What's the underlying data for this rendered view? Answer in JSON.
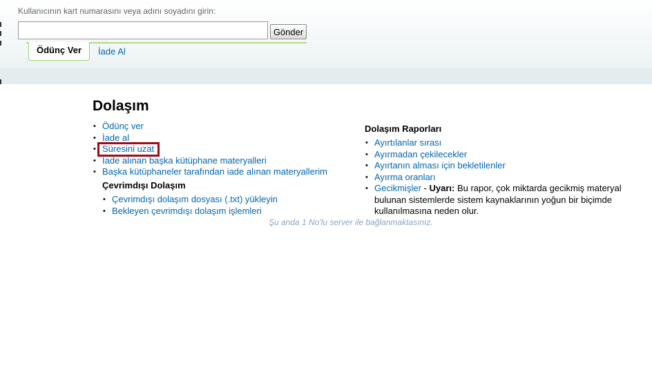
{
  "header": {
    "prompt": "Kullanıcının kart numarasını veya adını soyadını girin:",
    "input_value": "",
    "submit_label": "Gönder",
    "tabs": [
      {
        "label": "Ödünç Ver"
      },
      {
        "label": "İade Al"
      }
    ]
  },
  "main": {
    "title": "Dolaşım",
    "circulation_links": [
      {
        "label": "Ödünç ver"
      },
      {
        "label": "İade al"
      },
      {
        "label": "Süresini uzat"
      },
      {
        "label": "İade alınan başka kütüphane materyalleri"
      },
      {
        "label": "Başka kütüphaneler tarafından iade alınan materyallerim"
      }
    ],
    "offline": {
      "title": "Çevrimdışı Dolaşım",
      "links": [
        {
          "label": "Çevrimdışı dolaşım dosyası (.txt) yükleyin"
        },
        {
          "label": "Bekleyen çevrimdışı dolaşım işlemleri"
        }
      ]
    },
    "reports": {
      "title": "Dolaşım Raporları",
      "links": [
        {
          "label": "Ayırtılanlar sırası"
        },
        {
          "label": "Ayırmadan çekilecekler"
        },
        {
          "label": "Ayırtanın alması için bekletilenler"
        },
        {
          "label": "Ayırma oranları"
        }
      ],
      "overdues": {
        "label": "Gecikmişler",
        "separator": " - ",
        "warning_label": "Uyarı:",
        "warning_text": " Bu rapor, çok miktarda gecikmiş materyal bulunan sistemlerde sistem kaynaklarının yoğun bir biçimde kullanılmasına neden olur."
      }
    },
    "server_note": "Şu anda 1 No'lu server ile bağlanmaktasınız."
  },
  "colors": {
    "link": "#0066b2",
    "highlight_border": "#a40a14",
    "tab_border": "#9fd36a",
    "server_note": "#8aa6c1"
  }
}
